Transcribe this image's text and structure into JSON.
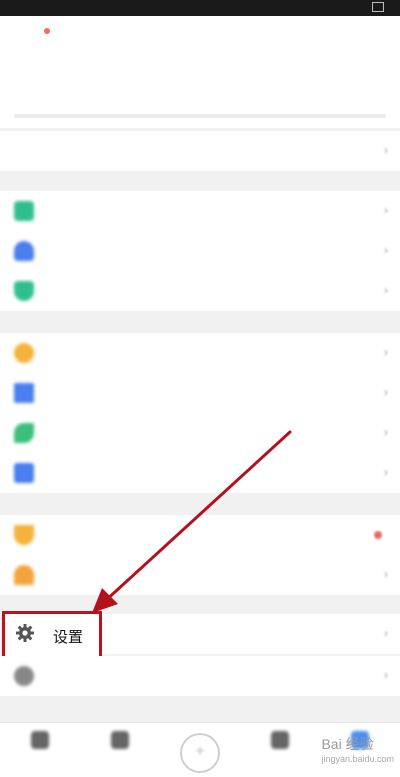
{
  "status_bar": {
    "left_text": "",
    "right_text": ""
  },
  "header": {
    "back_label": "",
    "title": ""
  },
  "storage": {
    "label": "",
    "value": ""
  },
  "manage_row": {
    "label": ""
  },
  "group_tools": [
    {
      "label": "",
      "icon": "note-icon",
      "color": "#2fbf8f"
    },
    {
      "label": "",
      "icon": "share-group-icon",
      "color": "#4a7ff0"
    },
    {
      "label": "",
      "icon": "shield-icon",
      "color": "#2fbf8f"
    }
  ],
  "group_files": [
    {
      "label": "",
      "icon": "star-icon",
      "color": "#f4b23a"
    },
    {
      "label": "",
      "icon": "download-icon",
      "color": "#4a7ff0"
    },
    {
      "label": "",
      "icon": "link-icon",
      "color": "#3cbf7a"
    },
    {
      "label": "",
      "icon": "trash-icon",
      "color": "#4a7ff0"
    }
  ],
  "group_services": [
    {
      "label": "",
      "icon": "diamond-icon",
      "color": "#f4b23a",
      "promo": ""
    },
    {
      "label": "",
      "icon": "warning-icon",
      "color": "#f4a33a"
    }
  ],
  "settings": {
    "label": "设置",
    "icon": "gear-icon"
  },
  "help_row": {
    "label": "",
    "icon": "help-icon"
  },
  "tabbar": {
    "tabs": [
      {
        "label": "",
        "icon": "home-tab-icon"
      },
      {
        "label": "",
        "icon": "files-tab-icon"
      },
      {
        "label": "",
        "icon": "add-icon"
      },
      {
        "label": "",
        "icon": "share-tab-icon"
      },
      {
        "label": "",
        "icon": "me-tab-icon"
      }
    ]
  },
  "watermark": {
    "text": "Bai 经验",
    "sub": "jingyan.baidu.com"
  },
  "colors": {
    "highlight": "#c0101a",
    "arrow": "#b3121c",
    "accent_red": "#e26b5f"
  }
}
